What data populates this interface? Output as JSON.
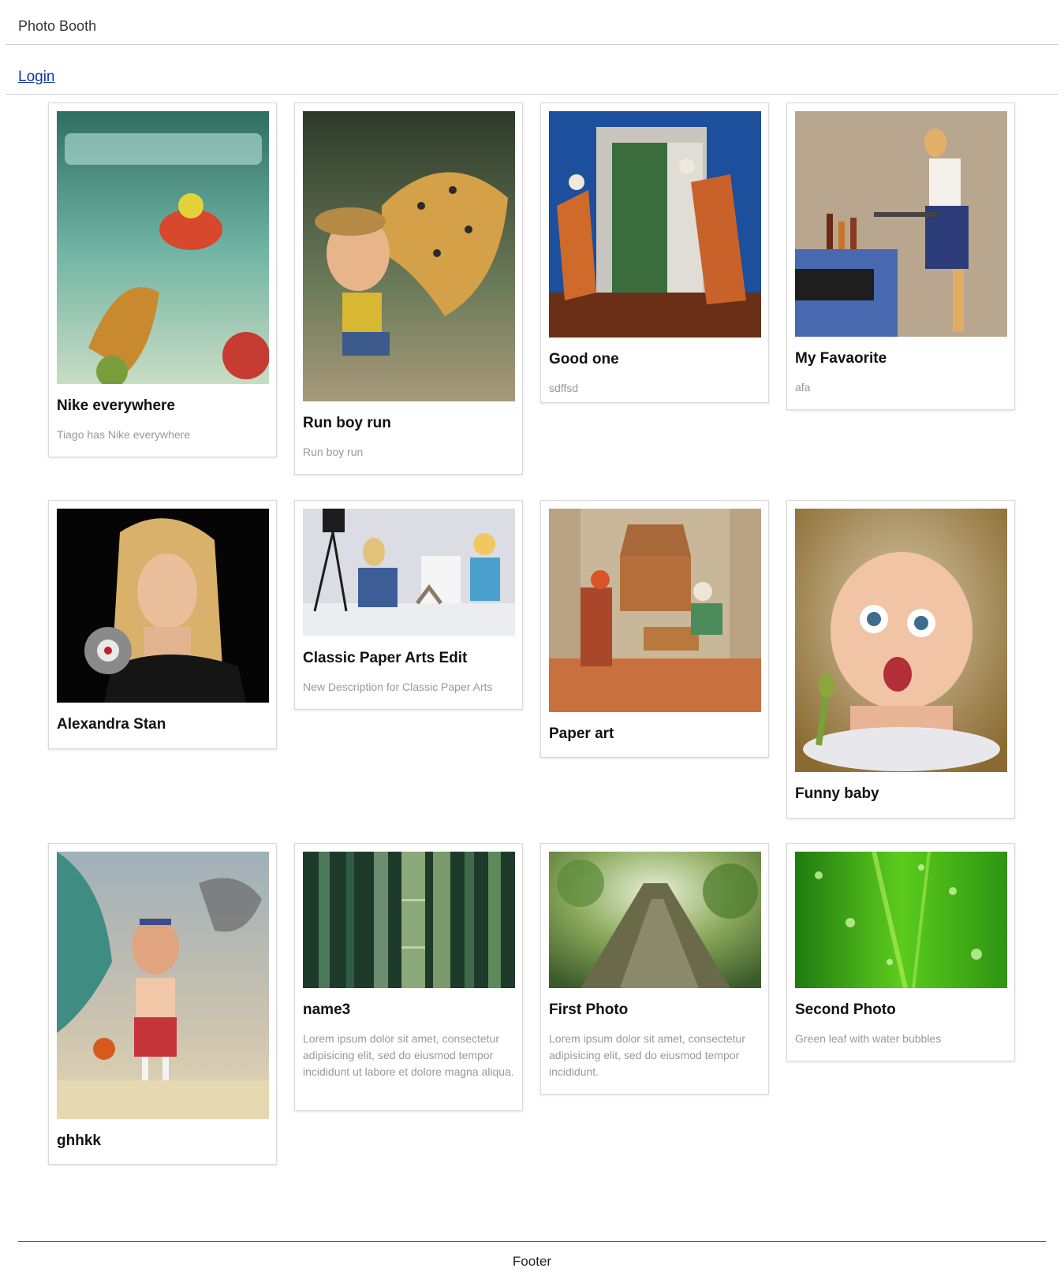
{
  "header": {
    "brand": "Photo Booth"
  },
  "nav": {
    "login": "Login"
  },
  "footer": {
    "text": "Footer"
  },
  "photos": [
    {
      "title": "Nike everywhere",
      "description": "Tiago has Nike everywhere",
      "image": "underwater-shoe-illustration"
    },
    {
      "title": "Run boy run",
      "description": "Run boy run",
      "image": "jaguar-chasing-boy-illustration"
    },
    {
      "title": "Good one",
      "description": "sdffsd",
      "image": "paper-art-open-door"
    },
    {
      "title": "My Favaorite",
      "description": "afa",
      "image": "paper-art-waitress"
    },
    {
      "title": "Alexandra Stan",
      "description": "",
      "image": "woman-with-headphones"
    },
    {
      "title": "Classic Paper Arts Edit",
      "description": "New Description for Classic Paper Arts",
      "image": "paper-art-photographer"
    },
    {
      "title": "Paper art",
      "description": "",
      "image": "paper-art-chess-players"
    },
    {
      "title": "Funny baby",
      "description": "",
      "image": "cartoon-baby-with-spoon"
    },
    {
      "title": "ghhkk",
      "description": "",
      "image": "tourist-on-beach-illustration"
    },
    {
      "title": "name3",
      "description": "Lorem ipsum dolor sit amet, consectetur adipisicing elit, sed do eiusmod tempor incididunt ut labore et dolore magna aliqua.",
      "image": "bamboo-forest"
    },
    {
      "title": "First Photo",
      "description": "Lorem ipsum dolor sit amet, consectetur adipisicing elit, sed do eiusmod tempor incididunt.",
      "image": "tree-trunk-low-angle"
    },
    {
      "title": "Second Photo",
      "description": "Green leaf with water bubbles",
      "image": "green-leaf-water-drops"
    }
  ]
}
